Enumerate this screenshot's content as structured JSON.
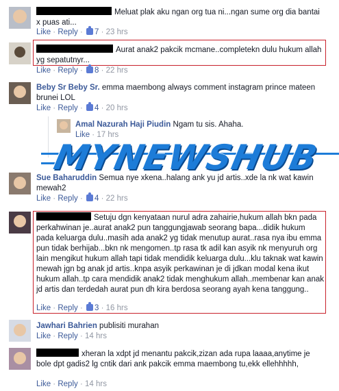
{
  "actions": {
    "like": "Like",
    "reply": "Reply",
    "sep": " · "
  },
  "comments": [
    {
      "name": "",
      "text": "Meluat plak aku ngan org tua ni...ngan sume org dia bantai x puas ati...",
      "likes": "7",
      "time": "23 hrs"
    },
    {
      "name": "",
      "text": "Aurat anak2 pakcik mcmane..completekn dulu hukum allah yg sepatutnyr...",
      "likes": "8",
      "time": "22 hrs"
    },
    {
      "name": "Beby Sr Beby Sr.",
      "text": "emma maembong always comment instagram prince mateen brunei LOL",
      "likes": "4",
      "time": "20 hrs"
    },
    {
      "name": "Amal Nazurah Haji Piudin",
      "text": "Ngam tu sis. Ahaha.",
      "likes": "",
      "time": "17 hrs"
    },
    {
      "name": "Sue Baharuddin",
      "text": "Semua nye xkena..halang ank yu jd artis..xde la nk wat kawin mewah2",
      "likes": "4",
      "time": "22 hrs"
    },
    {
      "name": "",
      "text": "Setuju dgn kenyataan nurul adra zahairie,hukum allah bkn pada perkahwinan je..aurat anak2 pun tanggungjawab seorang bapa...didik hukum pada keluarga dulu..masih ada anak2 yg tidak menutup aurat..rasa nya ibu emma pun tidak berhijab...bkn nk mengomen..tp rasa tk adil kan asyik nk menyuruh org lain mengikut hukum allah tapi tidak mendidik keluarga dulu...klu taknak wat kawin mewah jgn bg anak jd artis..knpa asyik perkawinan je di jdkan modal kena ikut hukum allah..tp cara mendidik anak2 tidak menghukum allah..membenar kan anak jd artis dan terdedah aurat pun dh kira berdosa seorang ayah kena tanggung..",
      "likes": "3",
      "time": "16 hrs"
    },
    {
      "name": "Jawhari Bahrien",
      "text": "publisiti murahan",
      "likes": "",
      "time": "14 hrs"
    },
    {
      "name": "",
      "text": "xheran la xdpt jd menantu pakcik,zizan ada rupa laaaa,anytime je bole dpt gadis2 lg cntik dari ank pakcik emma maembong tu,ekk ellehhhhh,",
      "likes": "",
      "time": "14 hrs"
    }
  ],
  "watermark": {
    "text": "MYNEWSHUB"
  },
  "colors": {
    "link": "#3b5998",
    "meta": "#9197a3",
    "highlight": "#c8202a",
    "watermark": "#1d7cd8"
  }
}
